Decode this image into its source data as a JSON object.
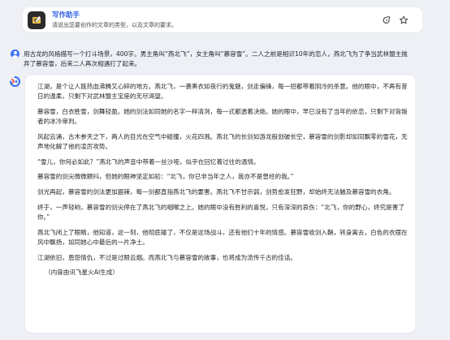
{
  "header": {
    "title": "写作助手",
    "description": "请说出您要创作的文章的类型，以及文章的要求。",
    "share_icon": "share-icon",
    "star_icon": "star-icon",
    "title_color": "#2b5ce6"
  },
  "user": {
    "message": "用古龙的风格描写一个打斗场景，400字。男主角叫“燕北飞”，女主角叫“慕容雪”。二人之前是相识10年的恋人，燕北飞为了争当武林盟主抛弃了慕容雪，后来二人再次相遇打了起来。",
    "avatar_color": "#3b74f2"
  },
  "answer": {
    "paragraphs": [
      "江湖，是个让人既热血沸腾又心碎的地方。燕北飞，一袭黑衣如夜行的鬼魅，剑走偏锋，每一招都带着阴冷的杀意。他的眼中，不再有昔日的温柔，只剩下对武林盟主宝座的无尽渴望。",
      "慕容雪，白衣胜雪，剑舞轻盈。她的剑法如同她的名字一样清冽，每一式都透着决绝。她的眼中，早已没有了当年的依恋，只剩下对背叛者的冰冷审判。",
      "风起云涌，古木参天之下，两人的目光在空气中碰撞，火花四溅。燕北飞的长剑如游龙般划破长空，慕容雪的剑影却如同飘零的雪花，无声地化解了他的凌厉攻势。",
      "“雪儿，你何必如此？”燕北飞的声音中带着一丝沙哑，似乎在回忆着过往的温情。",
      "慕容雪的剑尖微微颤抖，但她的眼神坚定如初：“北飞，你已非当年之人，我亦不是曾经的我。”",
      "剑光再起，慕容雪的剑法更加狠辣，每一剑都直指燕北飞的要害。燕北飞不甘示弱，剑势愈发狂野，却始终无法触及慕容雪的衣角。",
      "终于，一声轻响，慕容雪的剑尖停在了燕北飞的咽喉之上。她的眼中没有胜利的喜悦，只有深深的哀伤：“北飞，你的野心，终究是害了你。”",
      "燕北飞闭上了眼睛，他知道，这一刻，他彻底输了，不仅是这场战斗，还有他们十年的情感。慕容雪收剑入鞘，转身离去，白色的衣摆在风中飘扬，如同她心中最后的一片净土。",
      "江湖依旧，恩怨情仇，不过是过眼云烟。而燕北飞与慕容雪的故事，也将成为流传千古的佳话。"
    ],
    "credit": "（内容由讯飞星火AI生成）"
  }
}
